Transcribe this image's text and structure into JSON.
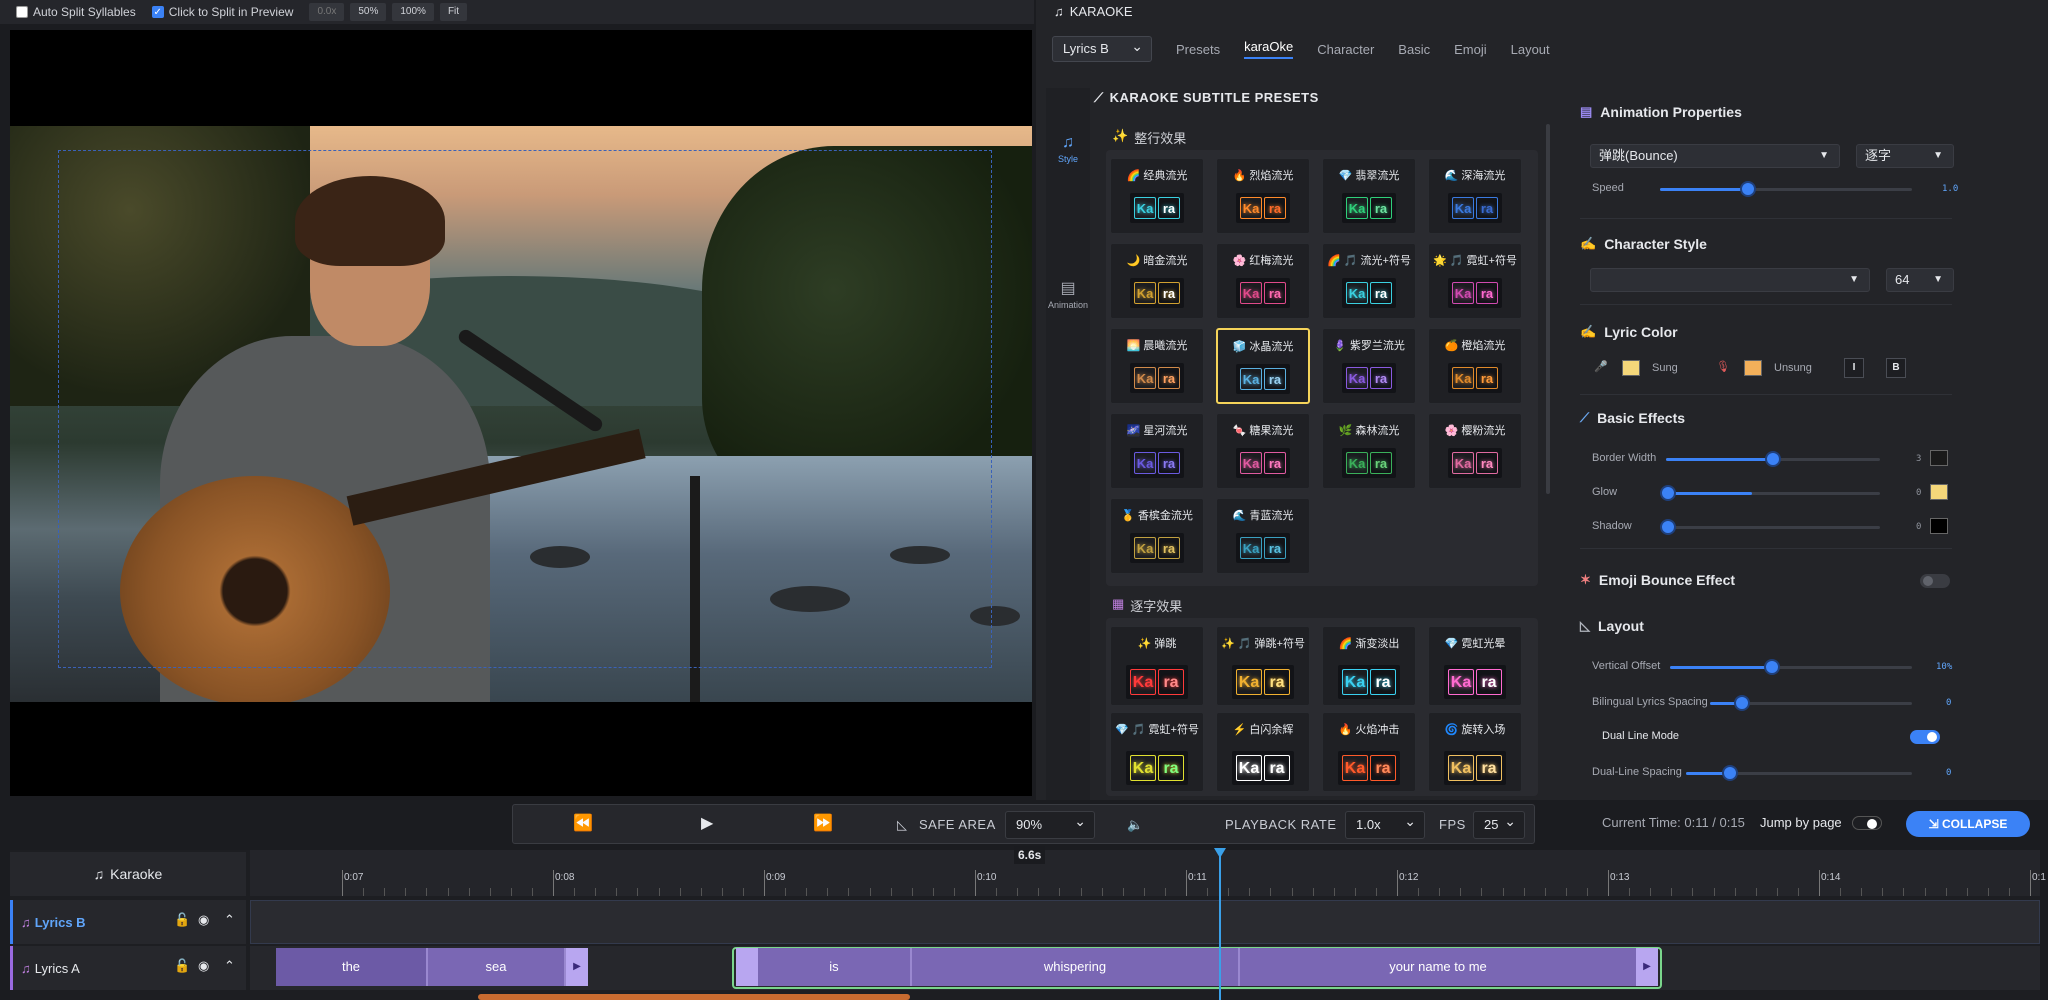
{
  "topbar": {
    "auto_split": "Auto Split Syllables",
    "click_split": "Click to Split in Preview",
    "zoom_a": "0.0x",
    "zoom_50": "50%",
    "zoom_100": "100%",
    "zoom_fit": "Fit"
  },
  "panel": {
    "title": "KARAOKE",
    "track_select": "Lyrics B",
    "tabs": [
      "Presets",
      "karaOke",
      "Character",
      "Basic",
      "Emoji",
      "Layout"
    ],
    "active_tab": "karaOke",
    "sidenav": {
      "style": "Style",
      "animation": "Animation"
    },
    "presets_title": "KARAOKE SUBTITLE PRESETS",
    "section_line": "整行效果",
    "section_char": "逐字效果",
    "ka": "Ka",
    "ra": "ra",
    "line_presets": [
      {
        "name": "经典流光",
        "icon": "🌈",
        "kc": "#3ad0e0",
        "rc": "#ffffff"
      },
      {
        "name": "烈焰流光",
        "icon": "🔥",
        "kc": "#ff8a2a",
        "rc": "#ff6a2a"
      },
      {
        "name": "翡翠流光",
        "icon": "💎",
        "kc": "#2fd07a",
        "rc": "#6fe0a0"
      },
      {
        "name": "深海流光",
        "icon": "🌊",
        "kc": "#3a7ae0",
        "rc": "#3a6ad0"
      },
      {
        "name": "暗金流光",
        "icon": "🌙",
        "kc": "#d0a030",
        "rc": "#ffffff"
      },
      {
        "name": "红梅流光",
        "icon": "🌸",
        "kc": "#e04a8a",
        "rc": "#ff6ab0"
      },
      {
        "name": "流光+符号",
        "icon": "🌈 🎵",
        "kc": "#3ad0e0",
        "rc": "#ffffff"
      },
      {
        "name": "霓虹+符号",
        "icon": "🌟 🎵",
        "kc": "#d04ab0",
        "rc": "#ff6ad0"
      },
      {
        "name": "晨曦流光",
        "icon": "🌅",
        "kc": "#d08a4a",
        "rc": "#ffa060"
      },
      {
        "name": "冰晶流光",
        "icon": "🧊",
        "kc": "#5ab0e0",
        "rc": "#9ad0f0"
      },
      {
        "name": "紫罗兰流光",
        "icon": "🪻",
        "kc": "#8a5ae0",
        "rc": "#b08af0"
      },
      {
        "name": "橙焰流光",
        "icon": "🍊",
        "kc": "#e08a2a",
        "rc": "#ff9a3a"
      },
      {
        "name": "星河流光",
        "icon": "🌌",
        "kc": "#6a5ae0",
        "rc": "#8a7af0"
      },
      {
        "name": "糖果流光",
        "icon": "🍬",
        "kc": "#e05aa0",
        "rc": "#ff7ac0"
      },
      {
        "name": "森林流光",
        "icon": "🌿",
        "kc": "#3ab05a",
        "rc": "#6ad07a"
      },
      {
        "name": "樱粉流光",
        "icon": "🌸",
        "kc": "#e06aa0",
        "rc": "#ff8ac0"
      },
      {
        "name": "香槟金流光",
        "icon": "🥇",
        "kc": "#c0a040",
        "rc": "#e0c060"
      },
      {
        "name": "青蓝流光",
        "icon": "🌊",
        "kc": "#3aa0c0",
        "rc": "#5ac0e0"
      }
    ],
    "char_presets": [
      {
        "name": "弹跳",
        "icon": "✨",
        "kc": "#ff3a3a",
        "rc": "#ff8a8a"
      },
      {
        "name": "弹跳+符号",
        "icon": "✨ 🎵",
        "kc": "#f0b030",
        "rc": "#ffe080"
      },
      {
        "name": "渐变淡出",
        "icon": "🌈",
        "kc": "#3ad0f0",
        "rc": "#ffffff"
      },
      {
        "name": "霓虹光晕",
        "icon": "💎",
        "kc": "#ff6ad0",
        "rc": "#ffffff"
      },
      {
        "name": "霓虹+符号",
        "icon": "💎 🎵",
        "kc": "#e0e030",
        "rc": "#80ff80"
      },
      {
        "name": "白闪余辉",
        "icon": "⚡",
        "kc": "#ffffff",
        "rc": "#ffffff"
      },
      {
        "name": "火焰冲击",
        "icon": "🔥",
        "kc": "#ff5a2a",
        "rc": "#ff8a5a"
      },
      {
        "name": "旋转入场",
        "icon": "🌀",
        "kc": "#f0c060",
        "rc": "#ffe0a0"
      }
    ]
  },
  "props": {
    "anim_title": "Animation Properties",
    "anim_select": "弹跳(Bounce)",
    "anim_mode": "逐字",
    "speed_label": "Speed",
    "speed_value": "1.0",
    "speed_level": 0.35,
    "char_title": "Character Style",
    "font_select": "",
    "font_size": "64",
    "color_title": "Lyric Color",
    "sung_label": "Sung",
    "unsung_label": "Unsung",
    "sung_color": "#f5d77a",
    "unsung_color": "#f3b05a",
    "italic": "I",
    "bold": "B",
    "effects_title": "Basic Effects",
    "border_label": "Border Width",
    "border_value": "3",
    "border_level": 0.5,
    "border_color": "#1a1a1a",
    "glow_label": "Glow",
    "glow_value": "0",
    "glow_color": "#f5d77a",
    "shadow_label": "Shadow",
    "shadow_value": "0",
    "shadow_color": "#000000",
    "emoji_title": "Emoji Bounce Effect",
    "layout_title": "Layout",
    "vertical_label": "Vertical Offset",
    "vertical_value": "10%",
    "vertical_level": 0.42,
    "bilingual_label": "Bilingual Lyrics Spacing",
    "bilingual_value": "0",
    "dual_label": "Dual Line Mode",
    "dualspacing_label": "Dual-Line Spacing",
    "dualspacing_value": "0"
  },
  "transport": {
    "safe_area": "SAFE AREA",
    "zoom": "90%",
    "playback_label": "PLAYBACK RATE",
    "rate": "1.0x",
    "fps_label": "FPS",
    "fps": "25",
    "current_time": "Current Time: 0:11 / 0:15",
    "jump_label": "Jump by page",
    "collapse": "COLLAPSE"
  },
  "timeline": {
    "karaoke_label": "Karaoke",
    "marker": "6.6s",
    "ticks": [
      "0:07",
      "0:08",
      "0:09",
      "0:10",
      "0:11",
      "0:12",
      "0:13",
      "0:14",
      "0:1"
    ],
    "track_b": "Lyrics B",
    "track_a": "Lyrics A",
    "clips": [
      "the",
      "sea",
      "is",
      "whispering",
      "your name to me"
    ]
  }
}
